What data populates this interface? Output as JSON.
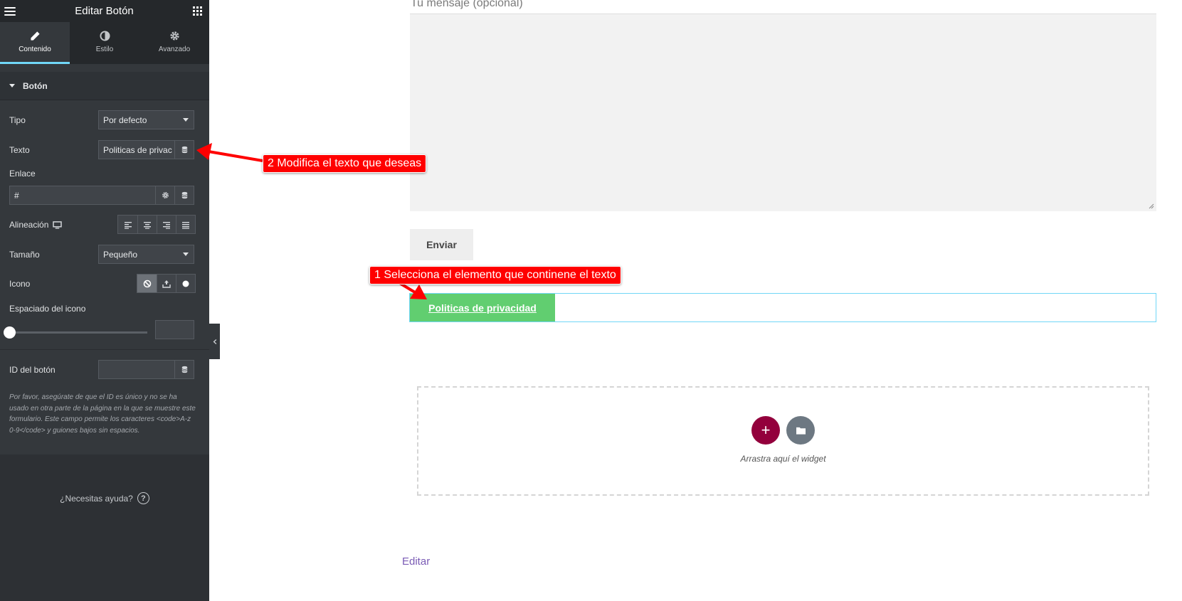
{
  "panel": {
    "title": "Editar Botón",
    "tabs": [
      {
        "label": "Contenido",
        "active": true
      },
      {
        "label": "Estilo",
        "active": false
      },
      {
        "label": "Avanzado",
        "active": false
      }
    ],
    "section": "Botón",
    "controls": {
      "tipo": {
        "label": "Tipo",
        "value": "Por defecto"
      },
      "texto": {
        "label": "Texto",
        "value": "Politicas de privac"
      },
      "enlace": {
        "label": "Enlace",
        "value": "#"
      },
      "alineacion": {
        "label": "Alineación"
      },
      "tamano": {
        "label": "Tamaño",
        "value": "Pequeño"
      },
      "icono": {
        "label": "Icono"
      },
      "espaciado": {
        "label": "Espaciado del icono",
        "value": ""
      },
      "id_boton": {
        "label": "ID del botón",
        "value": ""
      }
    },
    "help_text": "Por favor, asegúrate de que el ID es único y no se ha usado en otra parte de la página en la que se muestre este formulario. Este campo permite los caracteres <code>A-z 0-9</code> y guiones bajos sin espacios.",
    "help_link": "¿Necesitas ayuda?",
    "icons": [
      "hamburger-icon",
      "apps-grid-icon",
      "pencil-icon",
      "contrast-icon",
      "gear-icon",
      "database-icon",
      "monitor-icon",
      "align-left-icon",
      "align-center-icon",
      "align-right-icon",
      "align-justify-icon",
      "ban-icon",
      "upload-icon",
      "circle-icon",
      "chevron-left-icon"
    ],
    "accent": "#71d7f7"
  },
  "page": {
    "message_label": "Tu mensaje (opcional)",
    "send_button": "Enviar",
    "privacy_button": "Politicas de privacidad",
    "drop_hint": "Arrastra aquí el widget",
    "edit_link": "Editar",
    "button_color": "#61ce70",
    "add_color": "#93003c"
  },
  "annotations": {
    "step1": "1 Selecciona el elemento que continene el texto",
    "step2": "2 Modifica el texto que deseas",
    "color": "#ff0000"
  }
}
